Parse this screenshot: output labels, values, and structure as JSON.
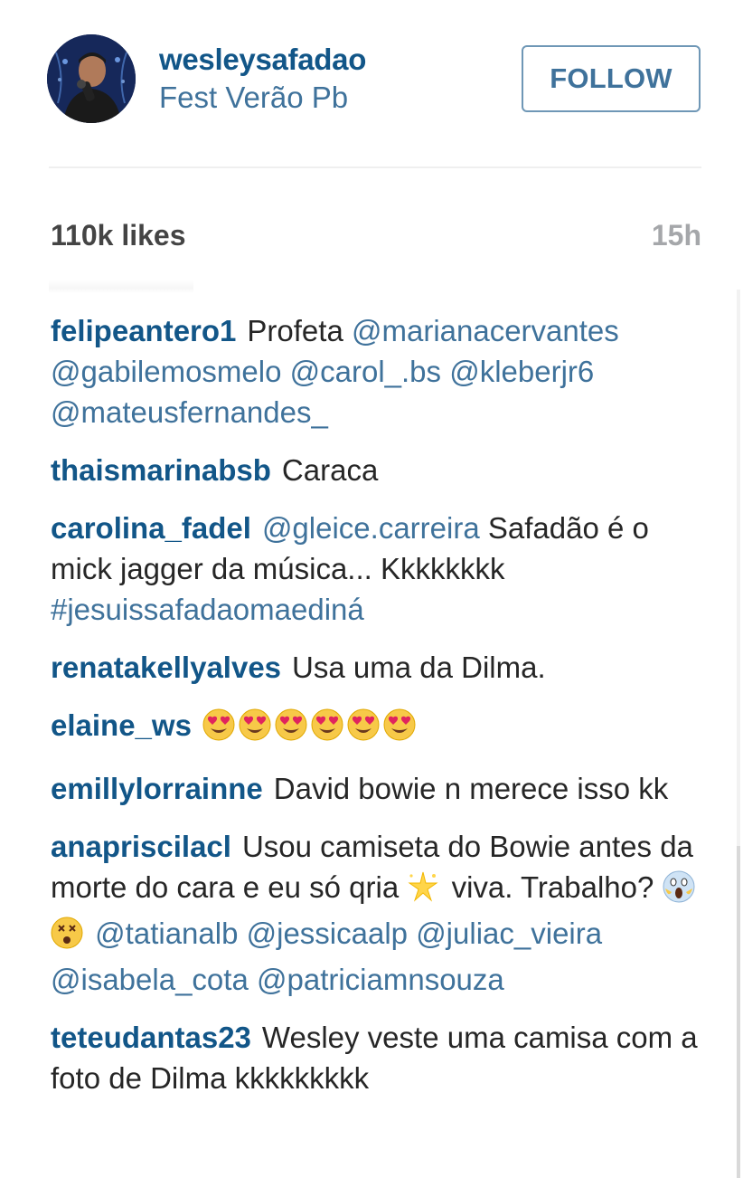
{
  "header": {
    "username": "wesleysafadao",
    "location": "Fest Verão Pb",
    "follow_label": "FOLLOW"
  },
  "stats": {
    "likes": "110k likes",
    "time": "15h"
  },
  "colors": {
    "username": "#125688",
    "link": "#3f729b",
    "text": "#262626",
    "muted": "#a5a7aa"
  },
  "comments": [
    {
      "author": "felipeantero1",
      "parts": [
        {
          "type": "text",
          "value": "Profeta"
        },
        {
          "type": "mention",
          "value": "@marianacervantes"
        },
        {
          "type": "mention",
          "value": "@gabilemosmelo"
        },
        {
          "type": "mention",
          "value": "@carol_.bs"
        },
        {
          "type": "mention",
          "value": "@kleberjr6"
        },
        {
          "type": "mention",
          "value": "@mateusfernandes_"
        }
      ]
    },
    {
      "author": "thaismarinabsb",
      "parts": [
        {
          "type": "text",
          "value": "Caraca"
        }
      ]
    },
    {
      "author": "carolina_fadel",
      "parts": [
        {
          "type": "mention",
          "value": "@gleice.carreira"
        },
        {
          "type": "text",
          "value": "Safadão é o mick jagger da música... Kkkkkkkk"
        },
        {
          "type": "hashtag",
          "value": "#jesuissafadaomaediná"
        }
      ]
    },
    {
      "author": "renatakellyalves",
      "parts": [
        {
          "type": "text",
          "value": "Usa uma da Dilma."
        }
      ]
    },
    {
      "author": "elaine_ws",
      "parts": [
        {
          "type": "emoji",
          "icon": "heart-eyes-emoji-icon",
          "count": 6
        }
      ]
    },
    {
      "author": "emillylorrainne",
      "parts": [
        {
          "type": "text",
          "value": "David bowie n merece isso kk"
        }
      ]
    },
    {
      "author": "anapriscilacl",
      "parts": [
        {
          "type": "text",
          "value": "Usou camiseta do Bowie antes da morte do cara e eu só qria"
        },
        {
          "type": "emoji",
          "icon": "sparkle-star-icon",
          "count": 1
        },
        {
          "type": "text",
          "value": "viva. Trabalho?"
        },
        {
          "type": "emoji",
          "icon": "screaming-face-icon",
          "count": 1
        },
        {
          "type": "emoji",
          "icon": "dizzy-face-icon",
          "count": 1
        },
        {
          "type": "mention",
          "value": "@tatianalb"
        },
        {
          "type": "mention",
          "value": "@jessicaalp"
        },
        {
          "type": "mention",
          "value": "@juliac_vieira"
        },
        {
          "type": "mention",
          "value": "@isabela_cota"
        },
        {
          "type": "mention",
          "value": "@patriciamnsouza"
        }
      ]
    },
    {
      "author": "teteudantas23",
      "parts": [
        {
          "type": "text",
          "value": "Wesley veste uma camisa com a foto de Dilma kkkkkkkkk"
        }
      ]
    }
  ]
}
